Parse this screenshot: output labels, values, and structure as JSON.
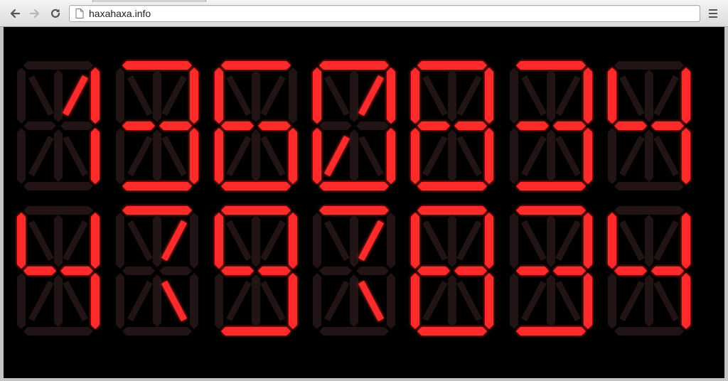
{
  "browser": {
    "url": "haxahaxa.info",
    "icons": {
      "back": "back-arrow-icon",
      "forward": "forward-arrow-icon",
      "reload": "reload-icon",
      "page": "page-icon",
      "menu": "hamburger-menu-icon"
    }
  },
  "display": {
    "type": "14-segment",
    "on_color": "#ff2a2a",
    "off_color": "#221414",
    "background": "#000000",
    "rows": [
      [
        [
          "b",
          "c",
          "j"
        ],
        [
          "a",
          "b",
          "g1",
          "g2",
          "c",
          "d"
        ],
        [
          "a",
          "f",
          "g1",
          "g2",
          "c",
          "d",
          "e"
        ],
        [
          "a",
          "b",
          "c",
          "d",
          "e",
          "f",
          "j",
          "k"
        ],
        [
          "a",
          "b",
          "c",
          "d",
          "e",
          "f",
          "g1",
          "g2"
        ],
        [
          "a",
          "b",
          "g1",
          "g2",
          "c",
          "d"
        ],
        [
          "b",
          "c",
          "f",
          "g1",
          "g2"
        ]
      ],
      [
        [
          "b",
          "c",
          "f",
          "g1",
          "g2"
        ],
        [
          "a",
          "j",
          "m"
        ],
        [
          "a",
          "b",
          "c",
          "d",
          "f",
          "g1",
          "g2"
        ],
        [
          "a",
          "j",
          "m"
        ],
        [
          "a",
          "b",
          "c",
          "d",
          "e",
          "f",
          "g1",
          "g2"
        ],
        [
          "a",
          "b",
          "g1",
          "g2",
          "c",
          "d"
        ],
        [
          "b",
          "c",
          "f",
          "g1",
          "g2"
        ]
      ]
    ]
  }
}
